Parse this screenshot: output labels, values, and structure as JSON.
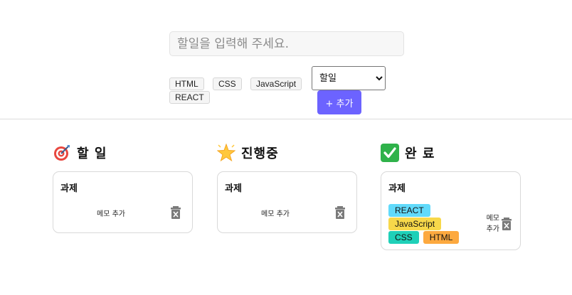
{
  "form": {
    "input_placeholder": "할일을 입력해 주세요.",
    "tags": [
      "HTML",
      "CSS",
      "JavaScript",
      "REACT"
    ],
    "status_select": {
      "selected": "할일"
    },
    "add_button": "+ 추가"
  },
  "columns": [
    {
      "title": "할 일",
      "icon": "dart-icon",
      "cards": [
        {
          "title": "과제",
          "memo_label": "메모 추가",
          "tags": []
        }
      ]
    },
    {
      "title": "진행중",
      "icon": "glowing-star-icon",
      "cards": [
        {
          "title": "과제",
          "memo_label": "메모 추가",
          "tags": []
        }
      ]
    },
    {
      "title": "완 료",
      "icon": "check-mark-icon",
      "cards": [
        {
          "title": "과제",
          "memo_label_line1": "메모",
          "memo_label_line2": "추가",
          "tags": [
            {
              "label": "REACT",
              "color": "#61dafb"
            },
            {
              "label": "JavaScript",
              "color": "#f7d84a"
            },
            {
              "label": "CSS",
              "color": "#1fd0b8"
            },
            {
              "label": "HTML",
              "color": "#fda93f"
            }
          ]
        }
      ]
    }
  ],
  "colors": {
    "add_button": "#6c63ff",
    "border": "#d9d9d9",
    "trash_icon": "#7a7a7a"
  }
}
